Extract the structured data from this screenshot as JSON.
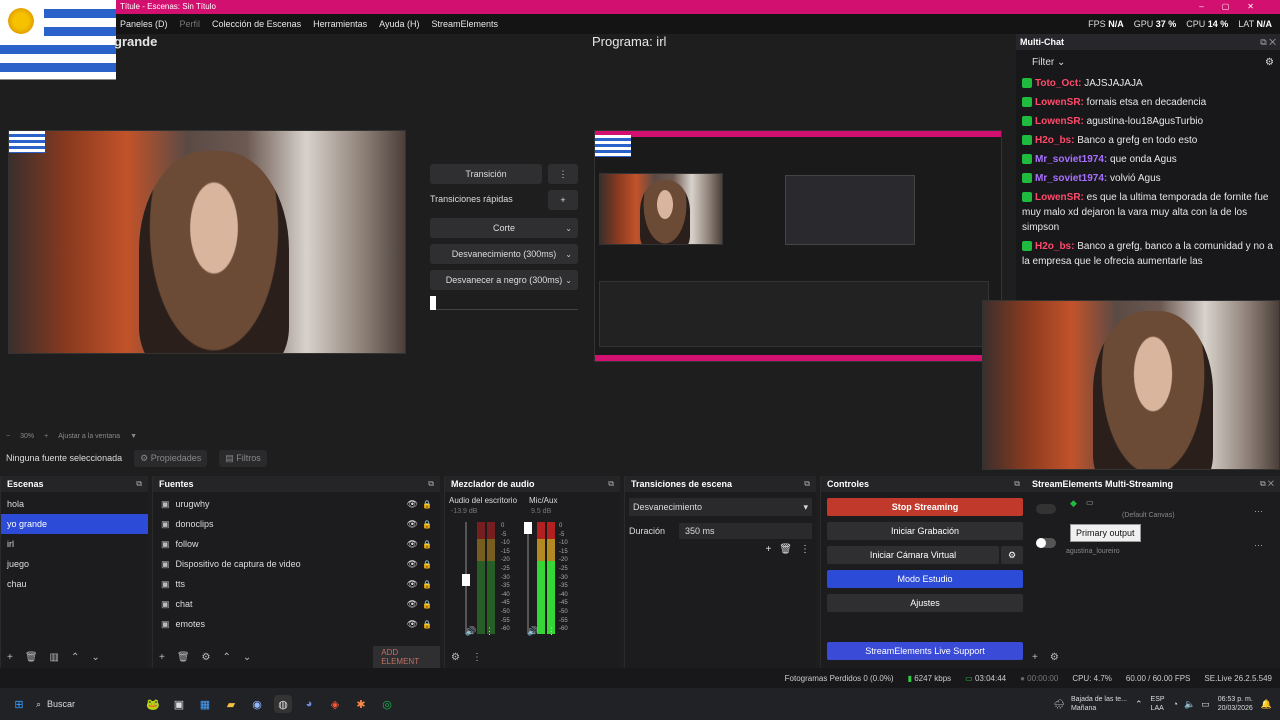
{
  "window": {
    "title": "Títule - Escenas: Sin Título"
  },
  "menu": [
    {
      "label": "Paneles (D)",
      "dim": false
    },
    {
      "label": "Perfil",
      "dim": true
    },
    {
      "label": "Colección de Escenas",
      "dim": false
    },
    {
      "label": "Herramientas",
      "dim": false
    },
    {
      "label": "Ayuda (H)",
      "dim": false
    },
    {
      "label": "StreamElements",
      "dim": false
    }
  ],
  "stats": {
    "fps_label": "FPS",
    "fps_value": "N/A",
    "gpu_label": "GPU",
    "gpu_value": "37 %",
    "cpu_label": "CPU",
    "cpu_value": "14 %",
    "lat_label": "LAT",
    "lat_value": "N/A"
  },
  "preview": {
    "title": "grande"
  },
  "program": {
    "title": "Programa: irl"
  },
  "transitions_center": {
    "transition_button": "Transición",
    "quick_label": "Transiciones rápidas",
    "items": [
      "Corte",
      "Desvanecimiento (300ms)",
      "Desvanecer a negro (300ms)"
    ]
  },
  "zoom": {
    "value": "30%",
    "fit": "Ajustar a la ventana"
  },
  "props_bar": {
    "no_source": "Ninguna fuente seleccionada",
    "properties": "Propiedades",
    "filters": "Filtros"
  },
  "scenes": {
    "title": "Escenas",
    "items": [
      {
        "label": "hola",
        "selected": false
      },
      {
        "label": "yo grande",
        "selected": true
      },
      {
        "label": "irl",
        "selected": false
      },
      {
        "label": "juego",
        "selected": false
      },
      {
        "label": "chau",
        "selected": false
      }
    ]
  },
  "sources": {
    "title": "Fuentes",
    "items": [
      "urugwhy",
      "donoclips",
      "follow",
      "Dispositivo de captura de video",
      "tts",
      "chat",
      "emotes"
    ],
    "add_element": "ADD ELEMENT"
  },
  "mixer": {
    "title": "Mezclador de audio",
    "channels": [
      {
        "name": "Audio del escritorio",
        "db": "-13.9 dB"
      },
      {
        "name": "Mic/Aux",
        "db": "9.5 dB"
      }
    ],
    "scale": [
      "0",
      "-5",
      "-10",
      "-15",
      "-20",
      "-25",
      "-30",
      "-35",
      "-40",
      "-45",
      "-50",
      "-55",
      "-60"
    ]
  },
  "scene_transitions": {
    "title": "Transiciones de escena",
    "selected": "Desvanecimiento",
    "duration_label": "Duración",
    "duration_value": "350 ms"
  },
  "controls": {
    "title": "Controles",
    "stop_streaming": "Stop Streaming",
    "start_recording": "Iniciar Grabación",
    "start_virtual_cam": "Iniciar Cámara Virtual",
    "studio_mode": "Modo Estudio",
    "settings": "Ajustes",
    "support": "StreamElements Live Support",
    "colors": {
      "stop": "#c0392b",
      "studio": "#2c4bd6",
      "support": "#3a4bd8"
    }
  },
  "multistream": {
    "title": "StreamElements Multi-Streaming",
    "tooltip": "Primary output",
    "canvas_label": "(Default Canvas)",
    "account": "agustina_loureiro"
  },
  "chat": {
    "title": "Multi-Chat",
    "filter": "Filter",
    "messages": [
      {
        "user": "Toto_Oct:",
        "text": "JAJSJAJAJA",
        "color": "#ff4a6a"
      },
      {
        "user": "LowenSR:",
        "text": "fornais etsa en decadencia",
        "color": "#ff4a6a"
      },
      {
        "user": "LowenSR:",
        "text": "agustina-lou18AgusTurbio",
        "color": "#ff4a6a"
      },
      {
        "user": "H2o_bs:",
        "text": "Banco a grefg en todo esto",
        "color": "#ff4a6a"
      },
      {
        "user": "Mr_soviet1974:",
        "text": "que onda Agus",
        "color": "#a970ff"
      },
      {
        "user": "Mr_soviet1974:",
        "text": "volvió Agus",
        "color": "#a970ff"
      },
      {
        "user": "LowenSR:",
        "text": "es que la ultima temporada de fornite fue muy malo xd dejaron la vara muy alta con la de los simpson",
        "color": "#ff4a6a"
      },
      {
        "user": "H2o_bs:",
        "text": "Banco a grefg, banco a la comunidad y no a la empresa que le ofrecia aumentarle las",
        "color": "#ff4a6a"
      }
    ]
  },
  "status": {
    "dropped": "Fotogramas Perdidos 0 (0.0%)",
    "kbps": "6247 kbps",
    "live_time": "03:04:44",
    "rec_time": "00:00:00",
    "cpu": "CPU: 4.7%",
    "fps": "60.00 / 60.00 FPS",
    "version": "SE.Live 26.2.5.549"
  },
  "taskbar": {
    "search": "Buscar",
    "weather_title": "Bajada de las te...",
    "weather_sub": "Mañana",
    "lang": "ESP",
    "lang2": "LAA",
    "time": "06:53 p. m.",
    "date": "20/03/2026"
  }
}
